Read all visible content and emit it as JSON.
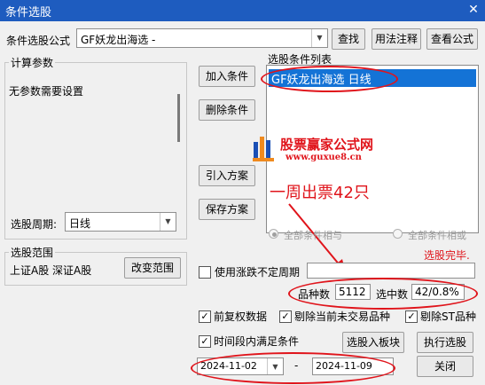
{
  "window": {
    "title": "条件选股",
    "close_glyph": "✕"
  },
  "formula_row": {
    "label": "条件选股公式",
    "value": "GF妖龙出海选  -",
    "find_button": "查找",
    "usage_button": "用法注释",
    "view_button": "查看公式"
  },
  "calc_params": {
    "group_label": "计算参数",
    "text": "无参数需要设置"
  },
  "period": {
    "label": "选股周期:",
    "value": "日线"
  },
  "buttons": {
    "add": "加入条件",
    "delete": "删除条件",
    "import": "引入方案",
    "save": "保存方案"
  },
  "condition_list": {
    "label": "选股条件列表",
    "items": [
      "GF妖龙出海选  日线"
    ]
  },
  "watermark": {
    "title": "股票赢家公式网",
    "url": "www.guxue8.cn"
  },
  "annotation": {
    "text": "一周出票42只",
    "color": "#e0141b"
  },
  "logic": {
    "and_label": "全部条件相与",
    "or_label": "全部条件相或"
  },
  "status": {
    "text": "选股完毕."
  },
  "range": {
    "group_label": "选股范围",
    "markets": "上证A股 深证A股",
    "change_button": "改变范围"
  },
  "variable_period": {
    "label": "使用涨跌不定周期",
    "checked": false
  },
  "stats": {
    "count_label": "品种数",
    "count_value": "5112",
    "selected_label": "选中数",
    "selected_value": "42/0.8%"
  },
  "options": {
    "adjusted": {
      "label": "前复权数据",
      "checked": true
    },
    "exclude_untraded": {
      "label": "剔除当前未交易品种",
      "checked": true
    },
    "exclude_st": {
      "label": "剔除ST品种",
      "checked": true
    },
    "period_condition": {
      "label": "时间段内满足条件",
      "checked": true
    }
  },
  "actions": {
    "to_sector": "选股入板块",
    "execute": "执行选股",
    "close": "关闭"
  },
  "dates": {
    "start": "2024-11-02",
    "separator": "-",
    "end": "2024-11-09"
  }
}
